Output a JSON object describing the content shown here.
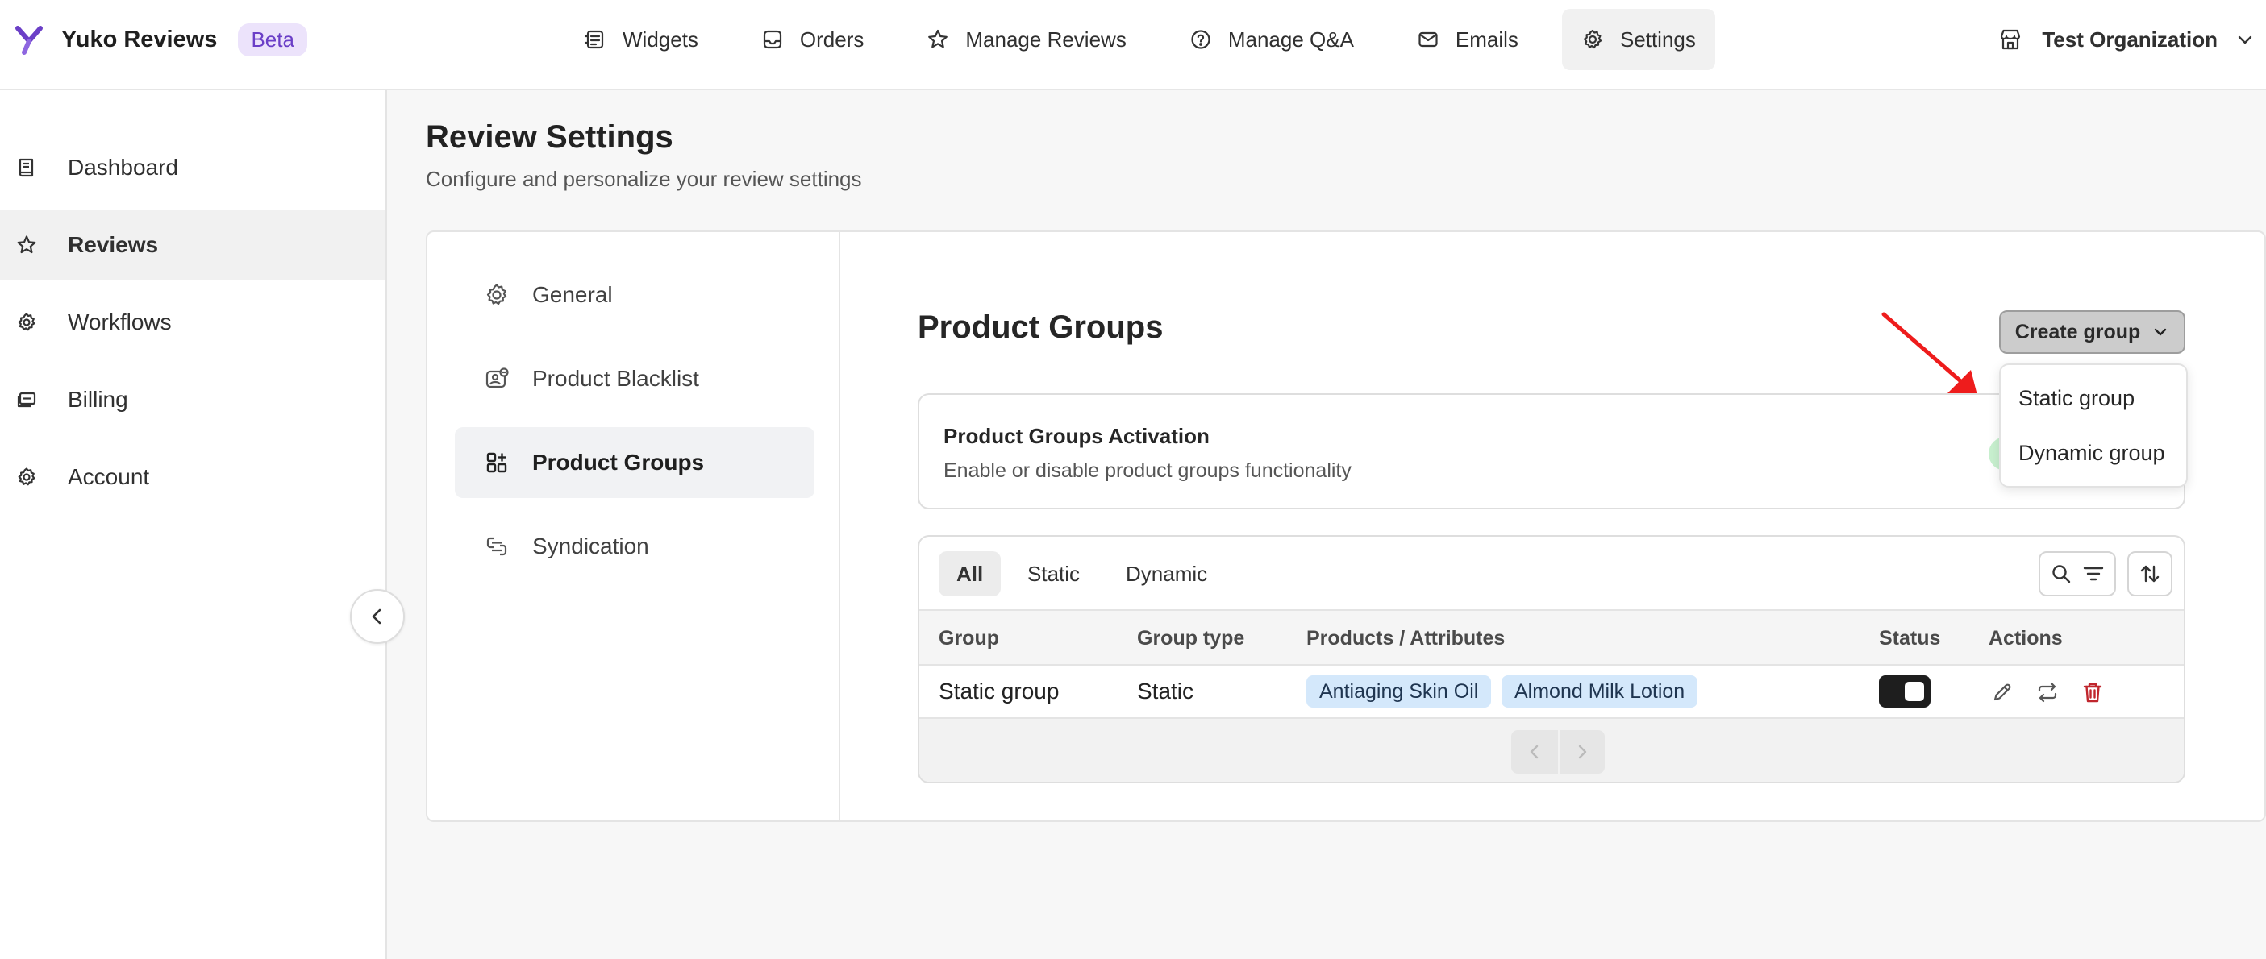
{
  "brand": {
    "name": "Yuko Reviews",
    "badge": "Beta",
    "accent": "#6b3fc7"
  },
  "topnav": {
    "items": [
      {
        "label": "Widgets",
        "icon": "widgets-icon"
      },
      {
        "label": "Orders",
        "icon": "inbox-icon"
      },
      {
        "label": "Manage Reviews",
        "icon": "star-icon"
      },
      {
        "label": "Manage Q&A",
        "icon": "question-circle-icon"
      },
      {
        "label": "Emails",
        "icon": "mail-icon"
      },
      {
        "label": "Settings",
        "icon": "gear-icon",
        "active": true
      }
    ],
    "organization": "Test Organization"
  },
  "sidebar": {
    "items": [
      {
        "label": "Dashboard",
        "icon": "book-icon"
      },
      {
        "label": "Reviews",
        "icon": "star-icon",
        "active": true
      },
      {
        "label": "Workflows",
        "icon": "cogs-icon"
      },
      {
        "label": "Billing",
        "icon": "card-icon"
      },
      {
        "label": "Account",
        "icon": "gear-icon"
      }
    ]
  },
  "page": {
    "title": "Review Settings",
    "subtitle": "Configure and personalize your review settings"
  },
  "settings_nav": {
    "items": [
      {
        "label": "General",
        "icon": "gear-icon"
      },
      {
        "label": "Product Blacklist",
        "icon": "product-block-icon"
      },
      {
        "label": "Product Groups",
        "icon": "grid-plus-icon",
        "active": true
      },
      {
        "label": "Syndication",
        "icon": "syndication-icon"
      }
    ]
  },
  "product_groups": {
    "title": "Product Groups",
    "create_button": "Create group",
    "dropdown": [
      "Static group",
      "Dynamic group"
    ],
    "activation": {
      "title": "Product Groups Activation",
      "description": "Enable or disable product groups functionality"
    },
    "filter_tabs": [
      "All",
      "Static",
      "Dynamic"
    ],
    "active_filter": "All",
    "columns": {
      "group": "Group",
      "group_type": "Group type",
      "products": "Products / Attributes",
      "status": "Status",
      "actions": "Actions"
    },
    "rows": [
      {
        "group": "Static group",
        "group_type": "Static",
        "products": [
          "Antiaging Skin Oil",
          "Almond Milk Lotion"
        ],
        "status_on": true
      }
    ]
  },
  "colors": {
    "annotation_arrow": "#ee1c1c",
    "delete": "#c0262d",
    "chip_bg": "#d4e8fb",
    "toggle_on": "#1e1e1e"
  }
}
